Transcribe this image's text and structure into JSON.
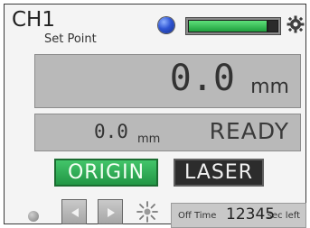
{
  "header": {
    "channel": "CH1",
    "subtitle": "Set Point",
    "status_led_color": "#2f55d4",
    "progress_percent": 88,
    "progress_color": "#1f9f3d"
  },
  "main_display": {
    "value": "0.0",
    "unit": "mm"
  },
  "status_display": {
    "value": "0.0",
    "unit": "mm",
    "state": "READY"
  },
  "buttons": {
    "origin_label": "ORIGIN",
    "laser_label": "LASER",
    "origin_color": "#229645"
  },
  "footer": {
    "time_label": "Off  Time",
    "time_value": "12345",
    "time_unit": "sec left"
  },
  "icons": [
    "status-led-icon",
    "gear-icon",
    "arrow-left-icon",
    "arrow-right-icon",
    "sun-icon",
    "indicator-dot-icon"
  ]
}
